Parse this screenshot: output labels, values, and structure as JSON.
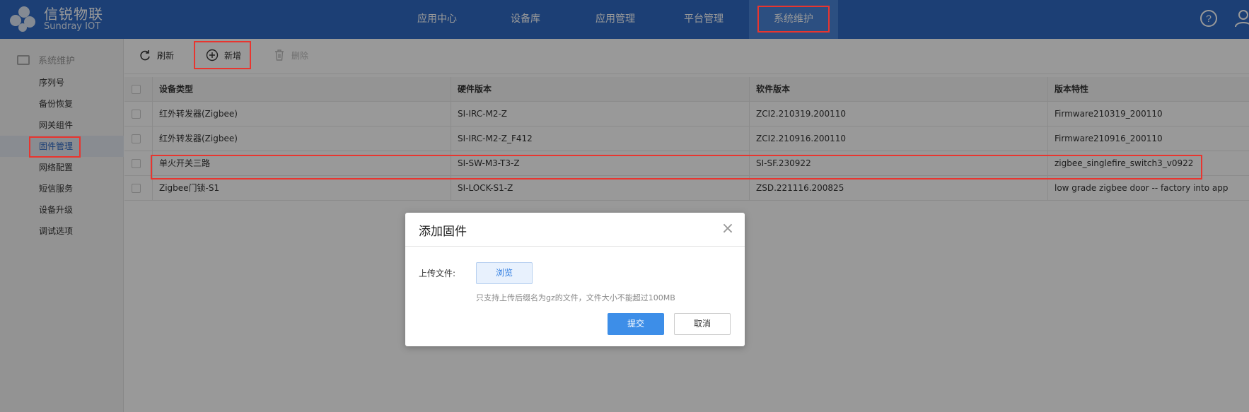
{
  "brand": {
    "name_cn": "信锐物联",
    "name_en": "Sundray IOT"
  },
  "nav": {
    "items": [
      {
        "label": "应用中心"
      },
      {
        "label": "设备库"
      },
      {
        "label": "应用管理"
      },
      {
        "label": "平台管理"
      },
      {
        "label": "系统维护"
      }
    ]
  },
  "sidebar": {
    "group_label": "系统维护",
    "items": [
      {
        "label": "序列号"
      },
      {
        "label": "备份恢复"
      },
      {
        "label": "网关组件"
      },
      {
        "label": "固件管理"
      },
      {
        "label": "网络配置"
      },
      {
        "label": "短信服务"
      },
      {
        "label": "设备升级"
      },
      {
        "label": "调试选项"
      }
    ]
  },
  "toolbar": {
    "refresh_label": "刷新",
    "add_label": "新增",
    "delete_label": "删除"
  },
  "table": {
    "columns": [
      "设备类型",
      "硬件版本",
      "软件版本",
      "版本特性"
    ],
    "rows": [
      {
        "type": "红外转发器(Zigbee)",
        "hw": "SI-IRC-M2-Z",
        "sw": "ZCI2.210319.200110",
        "feature": "Firmware210319_200110"
      },
      {
        "type": "红外转发器(Zigbee)",
        "hw": "SI-IRC-M2-Z_F412",
        "sw": "ZCI2.210916.200110",
        "feature": "Firmware210916_200110"
      },
      {
        "type": "单火开关三路",
        "hw": "SI-SW-M3-T3-Z",
        "sw": "SI-SF.230922",
        "feature": "zigbee_singlefire_switch3_v0922"
      },
      {
        "type": "Zigbee门锁-S1",
        "hw": "SI-LOCK-S1-Z",
        "sw": "ZSD.221116.200825",
        "feature": "low grade zigbee door -- factory into app"
      }
    ]
  },
  "modal": {
    "title": "添加固件",
    "upload_label": "上传文件:",
    "browse_label": "浏览",
    "hint": "只支持上传后缀名为gz的文件，文件大小不能超过100MB",
    "submit_label": "提交",
    "cancel_label": "取消"
  },
  "colors": {
    "header": "#2f6ac4",
    "accent": "#3d8ee8",
    "highlight": "#e8352f"
  }
}
